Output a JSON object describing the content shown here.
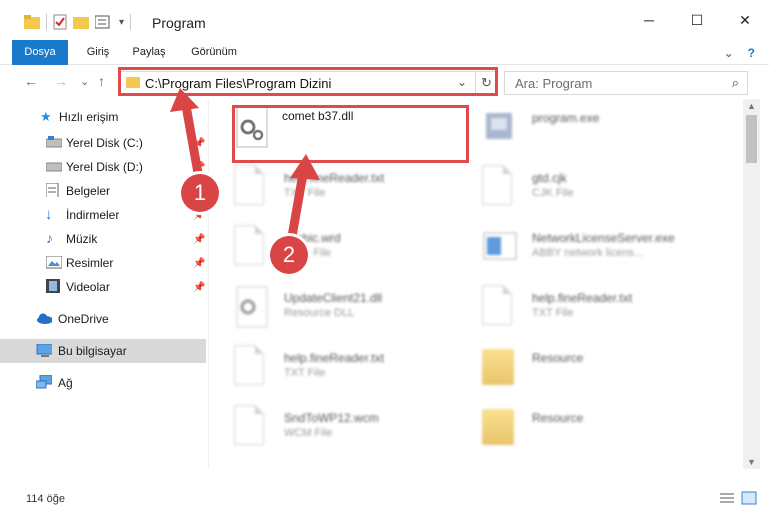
{
  "window": {
    "title": "Program",
    "minimize": "─",
    "maximize": "☐",
    "close": "✕"
  },
  "ribbon": {
    "tabs": [
      "Dosya",
      "Giriş",
      "Paylaş",
      "Görünüm"
    ],
    "expand": "⌄",
    "help": "?"
  },
  "nav": {
    "back": "←",
    "forward": "→",
    "recent": "⌄",
    "up": "↑",
    "address": "C:\\Program Files\\Program Dizini",
    "address_dropdown": "⌄",
    "refresh": "↻",
    "search_placeholder": "Ara: Program",
    "search_icon": "⌕"
  },
  "sidebar": {
    "items": [
      {
        "label": "Hızlı erişim",
        "icon": "star-icon",
        "pinned": false
      },
      {
        "label": "Yerel Disk (C:)",
        "icon": "drive-icon",
        "pinned": true
      },
      {
        "label": "Yerel Disk (D:)",
        "icon": "drive-icon",
        "pinned": true
      },
      {
        "label": "Belgeler",
        "icon": "documents-icon",
        "pinned": true
      },
      {
        "label": "İndirmeler",
        "icon": "download-icon",
        "pinned": true
      },
      {
        "label": "Müzik",
        "icon": "music-icon",
        "pinned": true
      },
      {
        "label": "Resimler",
        "icon": "pictures-icon",
        "pinned": true
      },
      {
        "label": "Videolar",
        "icon": "videos-icon",
        "pinned": true
      },
      {
        "label": "OneDrive",
        "icon": "cloud-icon",
        "pinned": false
      },
      {
        "label": "Bu bilgisayar",
        "icon": "computer-icon",
        "pinned": false,
        "selected": true
      },
      {
        "label": "Ağ",
        "icon": "network-icon",
        "pinned": false
      }
    ],
    "pin_glyph": "📌"
  },
  "files": [
    {
      "name": "comet b37.dll",
      "type": "",
      "icon": "dll-file-icon",
      "highlighted": true
    },
    {
      "name": "program.exe",
      "type": "",
      "icon": "exe-file-icon"
    },
    {
      "name": "help.fineReader.txt",
      "type": "TXT File",
      "icon": "text-file-icon"
    },
    {
      "name": "gtd.cjk",
      "type": "CJK File",
      "icon": "generic-file-icon"
    },
    {
      "name": "Arabic.wrd",
      "type": "WRD File",
      "icon": "generic-file-icon"
    },
    {
      "name": "NetworkLicenseServer.exe",
      "type": "ABBY network licens...",
      "icon": "exe-file-icon"
    },
    {
      "name": "UpdateClient21.dll",
      "type": "Resource DLL",
      "icon": "dll-file-icon"
    },
    {
      "name": "help.fineReader.txt",
      "type": "TXT File",
      "icon": "text-file-icon"
    },
    {
      "name": "help.fineReader.txt",
      "type": "TXT File",
      "icon": "text-file-icon"
    },
    {
      "name": "Resource",
      "type": "",
      "icon": "folder-icon"
    },
    {
      "name": "SndToWP12.wcm",
      "type": "WCM File",
      "icon": "generic-file-icon"
    },
    {
      "name": "Resource",
      "type": "",
      "icon": "folder-icon"
    }
  ],
  "status": {
    "count": "114 öğe"
  },
  "annotations": {
    "badge1": "1",
    "badge2": "2"
  },
  "colors": {
    "accent": "#1979ca",
    "highlight": "#e04a4a",
    "selected": "#d9d9d9"
  }
}
